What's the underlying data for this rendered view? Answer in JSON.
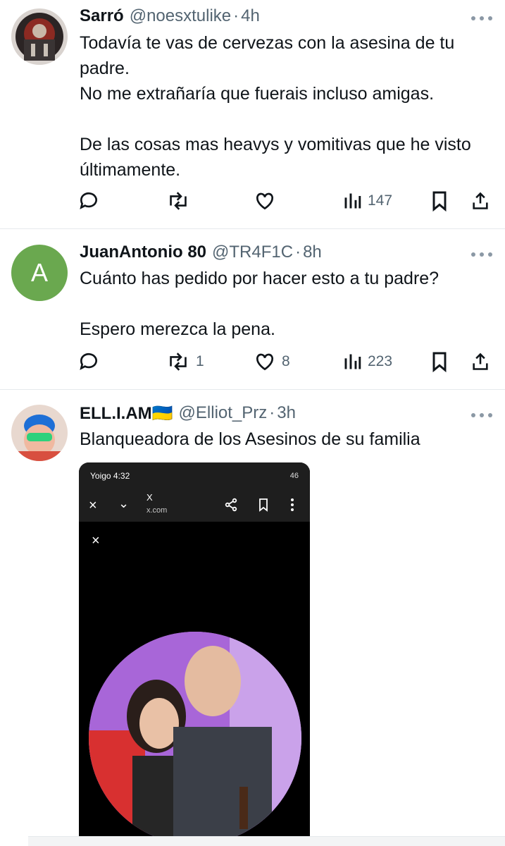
{
  "tweets": [
    {
      "name": "Sarró",
      "handle": "@noesxtulike",
      "sep": "·",
      "time": "4h",
      "text": "Todavía te vas de cervezas con la asesina de tu padre.\nNo me extrañaría que fuerais incluso amigas.\n\nDe las cosas mas heavys y vomitivas que he visto últimamente.",
      "reposts": "",
      "likes": "",
      "views": "147"
    },
    {
      "name": "JuanAntonio 80",
      "handle": "@TR4F1C",
      "sep": "·",
      "time": "8h",
      "avatar_letter": "A",
      "text": "Cuánto has pedido por hacer esto a tu padre?\n\nEspero merezca la pena.",
      "reposts": "1",
      "likes": "8",
      "views": "223"
    },
    {
      "name": "ELL.I.AM🇺🇦",
      "handle": "@Elliot_Prz",
      "sep": "·",
      "time": "3h",
      "text": "Blanqueadora de los Asesinos de su familia"
    }
  ],
  "embedded_screenshot": {
    "status_time": "Yoigo 4:32",
    "status_icons": "46",
    "page_title": "X",
    "page_url": "x.com",
    "close_glyph": "×"
  },
  "colors": {
    "text": "#0f1419",
    "secondary": "#536471",
    "divider": "#e6e9ec",
    "avatar_a": "#6aa84f"
  },
  "icons": [
    "reply-icon",
    "repost-icon",
    "like-icon",
    "views-icon",
    "bookmark-icon",
    "share-icon",
    "more-icon"
  ]
}
